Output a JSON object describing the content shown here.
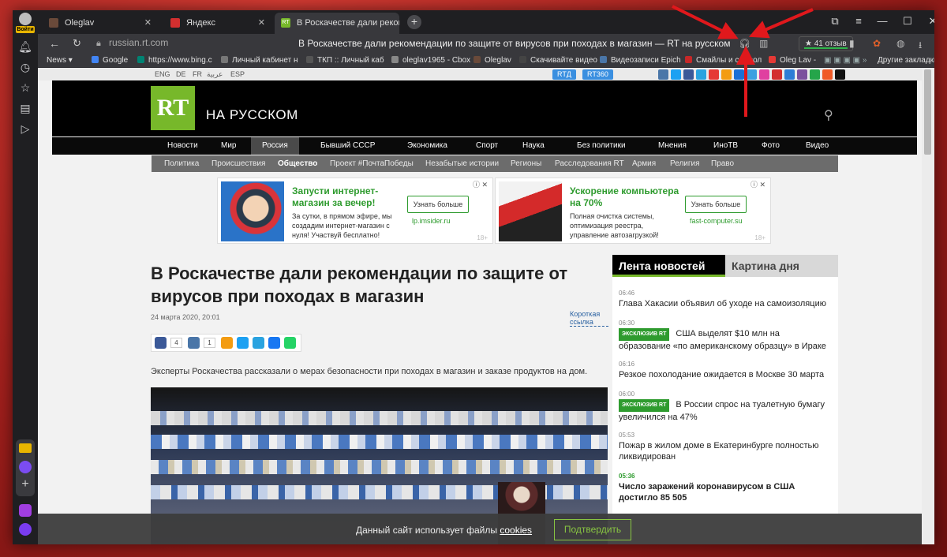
{
  "sidebar": {
    "login_label": "Войти"
  },
  "tabs": [
    {
      "label": "Oleglav",
      "fav_color": "#6a4a3a"
    },
    {
      "label": "Яндекс",
      "fav_color": "#d32f2f"
    },
    {
      "label": "В Роскачестве дали рекомендаци",
      "fav_color": "#77b82a",
      "fav_text": "RT"
    }
  ],
  "address": {
    "url": "russian.rt.com",
    "page_title": "В Роскачестве дали рекомендации по защите от вирусов при походах в магазин — RT на русском",
    "reviews": "★ 41 отзыв"
  },
  "bookmarks": [
    {
      "label": "News ▾",
      "color": ""
    },
    {
      "label": "Google",
      "color": "#4285f4"
    },
    {
      "label": "https://www.bing.c",
      "color": "#008373"
    },
    {
      "label": "Личный кабинет н",
      "color": "#777"
    },
    {
      "label": "ТКП :: Личный каб",
      "color": "#555"
    },
    {
      "label": "oleglav1965 - Cbox",
      "color": "#888"
    },
    {
      "label": "Oleglav",
      "color": "#6a4a3a"
    },
    {
      "label": "Скачивайте видео",
      "color": "#444"
    },
    {
      "label": "Видеозаписи Epich",
      "color": "#4a76a8"
    },
    {
      "label": "Смайлы и символ",
      "color": "#c62828"
    },
    {
      "label": "Oleg Lav -",
      "color": "#e53935"
    },
    {
      "label": "Другие закладки",
      "color": ""
    }
  ],
  "site": {
    "langs": [
      "ENG",
      "DE",
      "FR",
      "عربية",
      "ESP"
    ],
    "pills": [
      "RTД",
      "RT360"
    ],
    "logo": "RT",
    "logo_text": "НА РУССКОМ",
    "main_nav": [
      "Новости",
      "Мир",
      "Россия",
      "Бывший СССР",
      "Экономика",
      "Спорт",
      "Наука",
      "Без политики",
      "Мнения",
      "ИноТВ",
      "Фото",
      "Видео"
    ],
    "sub_nav": [
      "Политика",
      "Происшествия",
      "Общество",
      "Проект #ПочтаПобеды",
      "Незабытые истории",
      "Регионы",
      "Расследования RT",
      "Армия",
      "Религия",
      "Право"
    ]
  },
  "ads": [
    {
      "title": "Запусти интернет-магазин за вечер!",
      "desc": "За сутки, в прямом эфире, мы создадим интернет-магазин с нуля! Участвуй бесплатно!",
      "button": "Узнать больше",
      "domain": "lp.imsider.ru",
      "age": "18+"
    },
    {
      "title": "Ускорение компьютера на 70%",
      "desc": "Полная очистка системы, оптимизация реестра, управление автозагрузкой!",
      "button": "Узнать больше",
      "domain": "fast-computer.su",
      "age": "18+"
    }
  ],
  "article": {
    "title": "В Роскачестве дали рекомендации по защите от вирусов при походах в магазин",
    "date": "24 марта 2020, 20:01",
    "short_link": "Короткая ссылка",
    "share_counts": [
      "4",
      "1"
    ],
    "lead": "Эксперты Роскачества рассказали о мерах безопасности при походах в магазин и заказе продуктов на дом."
  },
  "news": {
    "tab1": "Лента новостей",
    "tab2": "Картина дня",
    "items": [
      {
        "time": "06:46",
        "title": "Глава Хакасии объявил об уходе на самоизоляцию",
        "exclusive": ""
      },
      {
        "time": "06:30",
        "title": "США выделят $10 млн на образование «по американскому образцу» в Ираке",
        "exclusive": "ЭКСКЛЮЗИВ RT"
      },
      {
        "time": "06:16",
        "title": "Резкое похолодание ожидается в Москве 30 марта",
        "exclusive": ""
      },
      {
        "time": "06:00",
        "title": "В России спрос на туалетную бумагу увеличился на 47%",
        "exclusive": "ЭКСКЛЮЗИВ RT"
      },
      {
        "time": "05:53",
        "title": "Пожар в жилом доме в Екатеринбурге полностью ликвидирован",
        "exclusive": ""
      },
      {
        "time": "05:36",
        "title": "Число заражений коронавирусом в США достигло 85 505",
        "exclusive": ""
      }
    ]
  },
  "cookie": {
    "text": "Данный сайт использует файлы",
    "link": "cookies",
    "button": "Подтвердить"
  },
  "colors": {
    "accent_green": "#77b82a",
    "annotation_red": "#e0181c"
  }
}
